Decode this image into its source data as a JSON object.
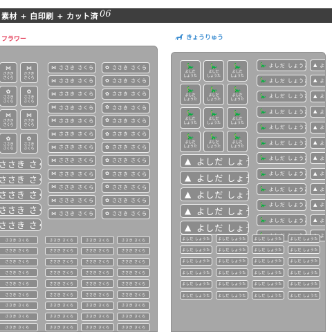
{
  "header": {
    "banner": "素材 + 白印刷 + カット済",
    "number": "06"
  },
  "themes": {
    "left": "フラワー",
    "right": "きょうりゅう"
  },
  "labels": {
    "left_name": "ささき さくら",
    "left_name_square": [
      "ささき",
      "さくら"
    ],
    "right_name": "よしだ しょうた",
    "right_name_square": [
      "よしだ",
      "しょうた"
    ]
  },
  "icons": {
    "left": [
      "ribbon-icon",
      "flower-icon"
    ],
    "right": [
      "dinosaur-icon",
      "stegosaurus-icon"
    ]
  },
  "colors": {
    "banner_bg": "#3e3e3e",
    "sheet": "#a7a7a7",
    "label": "#8c8c8c",
    "label_border": "#eeeeee",
    "left_title": "#e4415c",
    "right_title": "#3f8fd2"
  }
}
